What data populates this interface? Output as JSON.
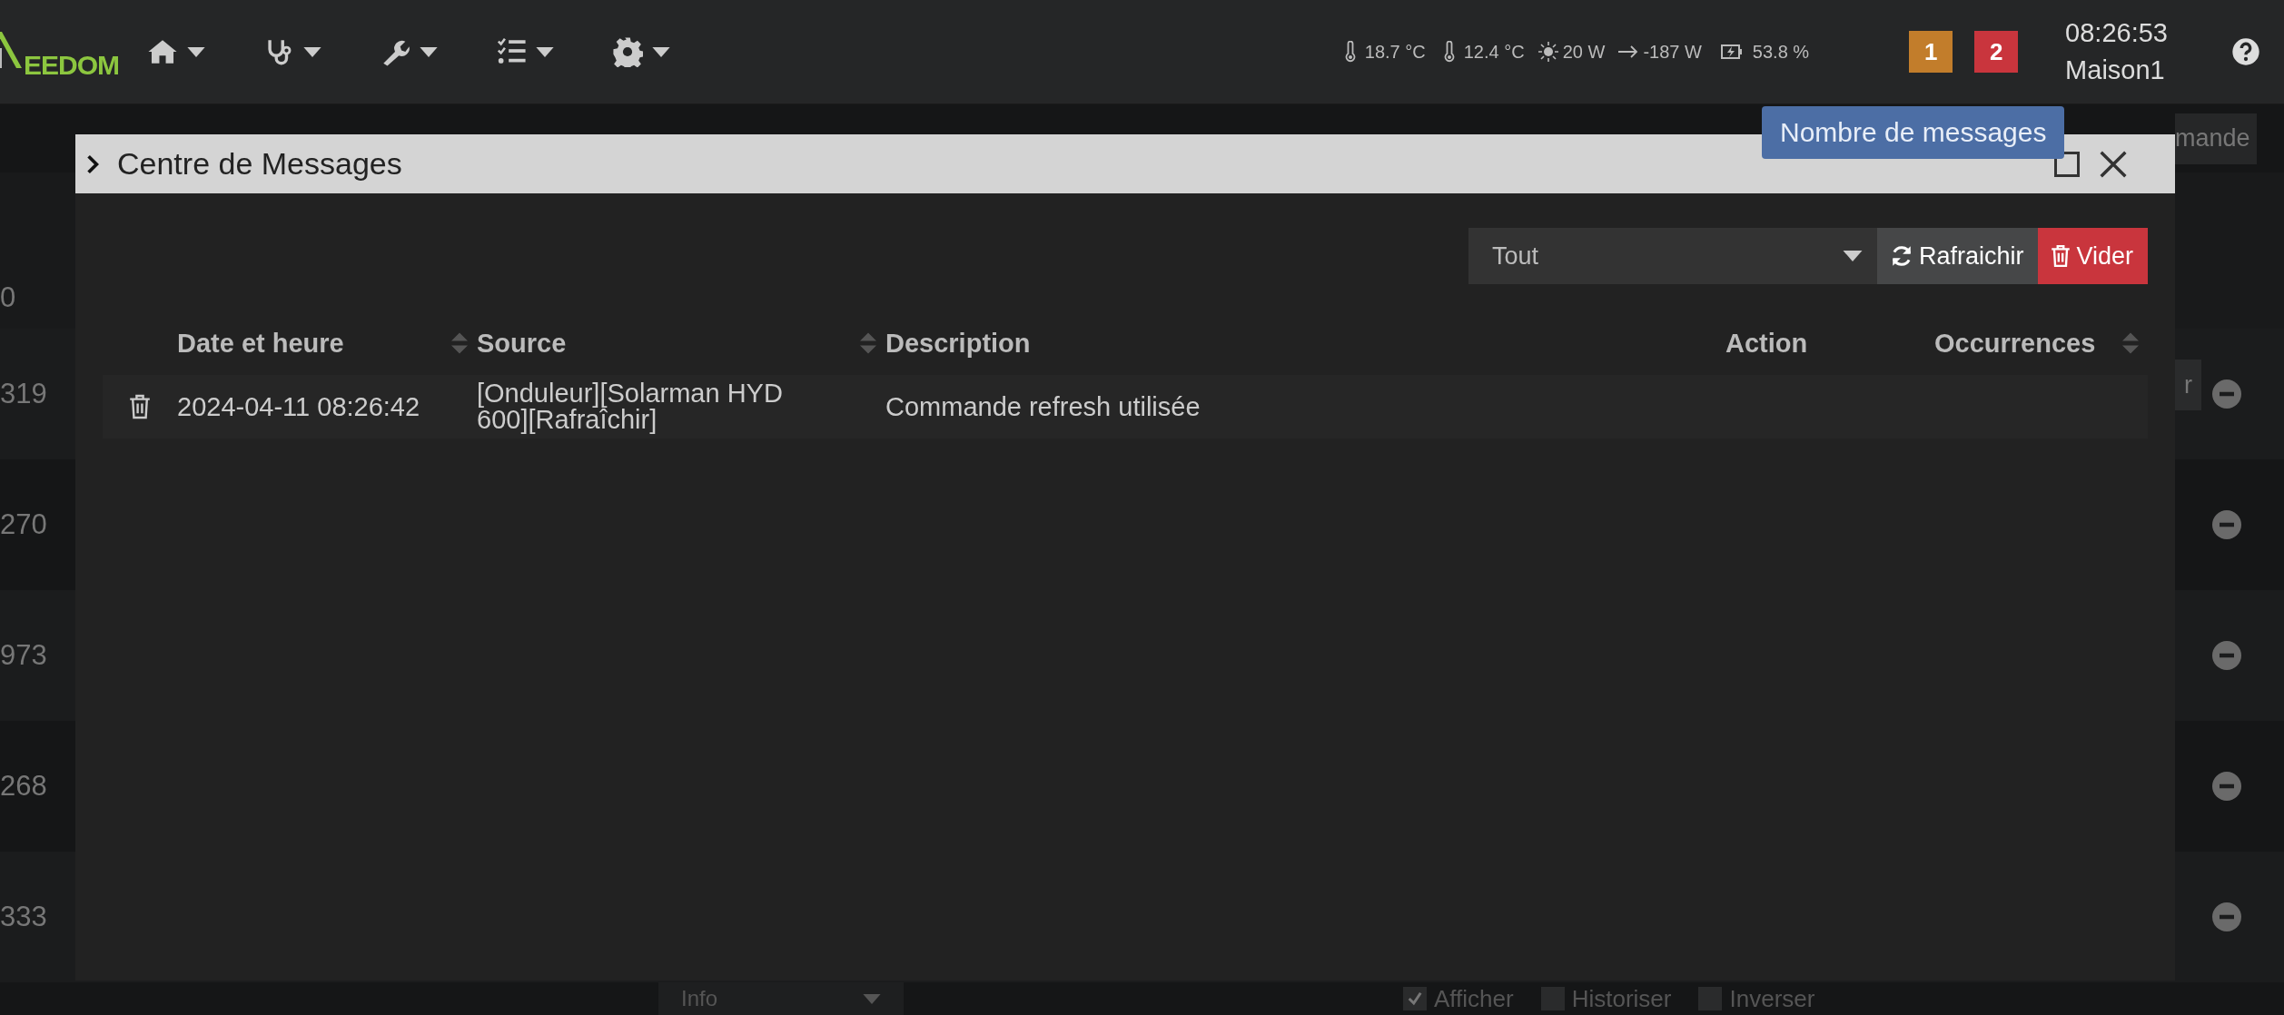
{
  "navbar": {
    "logo": [
      "EEDOM"
    ],
    "widgets": [
      {
        "kind": "thermometer",
        "text": "18.7 °C"
      },
      {
        "kind": "thermometer",
        "text": "12.4 °C"
      },
      {
        "kind": "sun",
        "text": "20 W"
      },
      {
        "kind": "arrow",
        "text": "-187 W"
      },
      {
        "kind": "battery",
        "text": "53.8 %"
      }
    ],
    "badges": [
      {
        "text": "1",
        "color": "#c27d2b"
      },
      {
        "text": "2",
        "color": "#c9353d"
      }
    ],
    "time": "08:26:53",
    "location": "Maison1"
  },
  "tooltip": "Nombre de messages",
  "background": {
    "top_button": "mande",
    "header_number": "0",
    "row_button": "r",
    "rows": [
      {
        "number": "319"
      },
      {
        "number": "270"
      },
      {
        "number": "973"
      },
      {
        "number": "268"
      },
      {
        "number": "333"
      }
    ],
    "bottom": {
      "select": "Info",
      "checkboxes": [
        {
          "label": "Afficher",
          "checked": true
        },
        {
          "label": "Historiser",
          "checked": false
        },
        {
          "label": "Inverser",
          "checked": false
        }
      ]
    }
  },
  "modal": {
    "title": "Centre de Messages",
    "filter": "Tout",
    "buttons": [
      {
        "kind": "refresh",
        "label": "Rafraichir"
      },
      {
        "kind": "delete",
        "label": "Vider"
      }
    ],
    "columns": [
      {
        "label": "Date et heure",
        "sortable": true
      },
      {
        "label": "Source",
        "sortable": true
      },
      {
        "label": "Description",
        "sortable": false
      },
      {
        "label": "Action",
        "sortable": false
      },
      {
        "label": "Occurrences",
        "sortable": true
      }
    ],
    "rows": [
      {
        "date": "2024-04-11 08:26:42",
        "source": "[Onduleur][Solarman HYD 600][Rafraîchir]",
        "description": "Commande refresh utilisée"
      }
    ]
  }
}
